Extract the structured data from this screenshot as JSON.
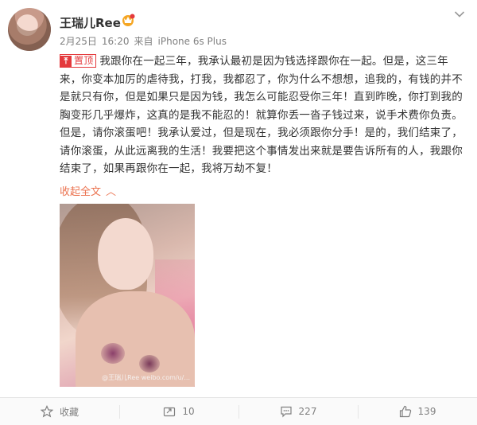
{
  "post": {
    "username": "王瑞儿Ree",
    "badge_icon": "vip-crown-icon",
    "meta": {
      "date": "2月25日",
      "time": "16:20",
      "source_prefix": "来自",
      "source": "iPhone 6s Plus"
    },
    "pin_label": "置顶",
    "text": "我跟你在一起三年，我承认最初是因为钱选择跟你在一起。但是，这三年来，你变本加厉的虐待我，打我，我都忍了，你为什么不想想，追我的，有钱的并不是就只有你，但是如果只是因为钱，我怎么可能忍受你三年！直到昨晚，你打到我的胸变形几乎爆炸，这真的是我不能忍的！就算你丢一沓子钱过来，说手术费你负责。但是，请你滚蛋吧！我承认爱过，但是现在，我必须跟你分手！是的，我们结束了，请你滚蛋，从此远离我的生活！我要把这个事情发出来就是要告诉所有的人，我跟你结束了，如果再跟你在一起，我将万劫不复！",
    "collapse_label": "收起全文",
    "photo_watermark": "@王瑞儿Ree weibo.com/u/..."
  },
  "footer": {
    "favorite_label": "收藏",
    "repost_count": "10",
    "comment_count": "227",
    "like_count": "139"
  },
  "colors": {
    "accent": "#eb7350",
    "pin": "#e4393c",
    "muted": "#808080"
  }
}
